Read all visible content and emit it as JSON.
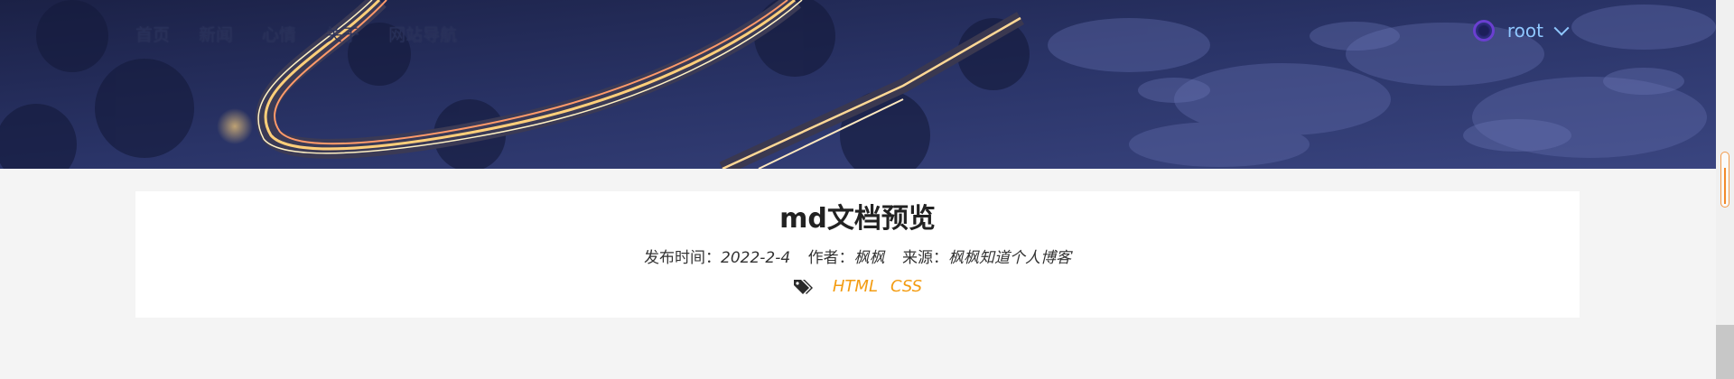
{
  "nav": {
    "items": [
      {
        "label": "首页"
      },
      {
        "label": "新闻"
      },
      {
        "label": "心情"
      },
      {
        "label": "关于"
      },
      {
        "label": "网站导航"
      }
    ]
  },
  "user": {
    "name": "root"
  },
  "article": {
    "title": "md文档预览",
    "publish_label": "发布时间：",
    "publish_date": "2022-2-4",
    "author_label": "作者：",
    "author": "枫枫",
    "source_label": "来源：",
    "source": "枫枫知道个人博客",
    "tags": [
      "HTML",
      "CSS"
    ]
  },
  "icons": {
    "avatar": "avatar-ring-icon",
    "dropdown": "chevron-down-icon",
    "tags": "tags-icon"
  },
  "colors": {
    "tag": "#f39c12",
    "user_name": "#8fc7ff",
    "background": "#f4f4f4"
  }
}
